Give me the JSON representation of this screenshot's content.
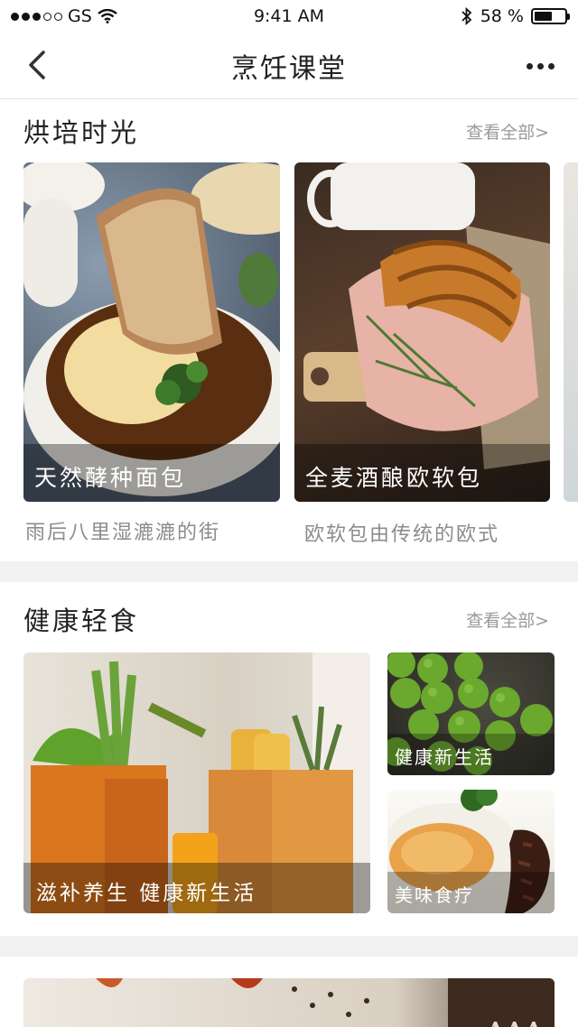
{
  "status_bar": {
    "carrier": "GS",
    "time": "9:41 AM",
    "battery_percent": "58 %",
    "battery_level": 0.58,
    "icons": [
      "signal-dots-icon",
      "wifi-icon",
      "bluetooth-icon",
      "battery-icon"
    ]
  },
  "nav": {
    "title": "烹饪课堂",
    "back_icon": "chevron-left-icon",
    "more_icon": "more-dots-icon"
  },
  "sections": {
    "baking": {
      "title": "烘培时光",
      "see_all": "查看全部>",
      "cards": [
        {
          "caption": "天然酵种面包",
          "subtitle": "雨后八里湿漉漉的街",
          "image": "onion-soup-bread"
        },
        {
          "caption": "全麦酒酿欧软包",
          "subtitle": "欧软包由传统的欧式",
          "image": "croissant-sandwich"
        }
      ]
    },
    "light_food": {
      "title": "健康轻食",
      "see_all": "查看全部>",
      "cards": [
        {
          "caption": "滋补养生 健康新生活",
          "image": "grocery-bags"
        },
        {
          "caption": "健康新生活",
          "image": "green-peas"
        },
        {
          "caption": "美味食疗",
          "image": "sea-cucumber-dessert"
        }
      ]
    }
  },
  "watermark": "AAA"
}
